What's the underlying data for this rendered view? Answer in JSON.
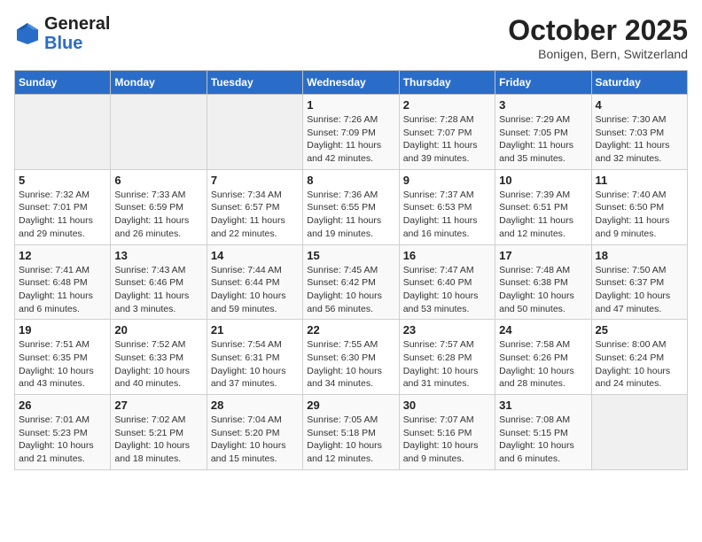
{
  "header": {
    "logo_line1": "General",
    "logo_line2": "Blue",
    "month": "October 2025",
    "location": "Bonigen, Bern, Switzerland"
  },
  "weekdays": [
    "Sunday",
    "Monday",
    "Tuesday",
    "Wednesday",
    "Thursday",
    "Friday",
    "Saturday"
  ],
  "weeks": [
    [
      {
        "day": "",
        "info": ""
      },
      {
        "day": "",
        "info": ""
      },
      {
        "day": "",
        "info": ""
      },
      {
        "day": "1",
        "info": "Sunrise: 7:26 AM\nSunset: 7:09 PM\nDaylight: 11 hours and 42 minutes."
      },
      {
        "day": "2",
        "info": "Sunrise: 7:28 AM\nSunset: 7:07 PM\nDaylight: 11 hours and 39 minutes."
      },
      {
        "day": "3",
        "info": "Sunrise: 7:29 AM\nSunset: 7:05 PM\nDaylight: 11 hours and 35 minutes."
      },
      {
        "day": "4",
        "info": "Sunrise: 7:30 AM\nSunset: 7:03 PM\nDaylight: 11 hours and 32 minutes."
      }
    ],
    [
      {
        "day": "5",
        "info": "Sunrise: 7:32 AM\nSunset: 7:01 PM\nDaylight: 11 hours and 29 minutes."
      },
      {
        "day": "6",
        "info": "Sunrise: 7:33 AM\nSunset: 6:59 PM\nDaylight: 11 hours and 26 minutes."
      },
      {
        "day": "7",
        "info": "Sunrise: 7:34 AM\nSunset: 6:57 PM\nDaylight: 11 hours and 22 minutes."
      },
      {
        "day": "8",
        "info": "Sunrise: 7:36 AM\nSunset: 6:55 PM\nDaylight: 11 hours and 19 minutes."
      },
      {
        "day": "9",
        "info": "Sunrise: 7:37 AM\nSunset: 6:53 PM\nDaylight: 11 hours and 16 minutes."
      },
      {
        "day": "10",
        "info": "Sunrise: 7:39 AM\nSunset: 6:51 PM\nDaylight: 11 hours and 12 minutes."
      },
      {
        "day": "11",
        "info": "Sunrise: 7:40 AM\nSunset: 6:50 PM\nDaylight: 11 hours and 9 minutes."
      }
    ],
    [
      {
        "day": "12",
        "info": "Sunrise: 7:41 AM\nSunset: 6:48 PM\nDaylight: 11 hours and 6 minutes."
      },
      {
        "day": "13",
        "info": "Sunrise: 7:43 AM\nSunset: 6:46 PM\nDaylight: 11 hours and 3 minutes."
      },
      {
        "day": "14",
        "info": "Sunrise: 7:44 AM\nSunset: 6:44 PM\nDaylight: 10 hours and 59 minutes."
      },
      {
        "day": "15",
        "info": "Sunrise: 7:45 AM\nSunset: 6:42 PM\nDaylight: 10 hours and 56 minutes."
      },
      {
        "day": "16",
        "info": "Sunrise: 7:47 AM\nSunset: 6:40 PM\nDaylight: 10 hours and 53 minutes."
      },
      {
        "day": "17",
        "info": "Sunrise: 7:48 AM\nSunset: 6:38 PM\nDaylight: 10 hours and 50 minutes."
      },
      {
        "day": "18",
        "info": "Sunrise: 7:50 AM\nSunset: 6:37 PM\nDaylight: 10 hours and 47 minutes."
      }
    ],
    [
      {
        "day": "19",
        "info": "Sunrise: 7:51 AM\nSunset: 6:35 PM\nDaylight: 10 hours and 43 minutes."
      },
      {
        "day": "20",
        "info": "Sunrise: 7:52 AM\nSunset: 6:33 PM\nDaylight: 10 hours and 40 minutes."
      },
      {
        "day": "21",
        "info": "Sunrise: 7:54 AM\nSunset: 6:31 PM\nDaylight: 10 hours and 37 minutes."
      },
      {
        "day": "22",
        "info": "Sunrise: 7:55 AM\nSunset: 6:30 PM\nDaylight: 10 hours and 34 minutes."
      },
      {
        "day": "23",
        "info": "Sunrise: 7:57 AM\nSunset: 6:28 PM\nDaylight: 10 hours and 31 minutes."
      },
      {
        "day": "24",
        "info": "Sunrise: 7:58 AM\nSunset: 6:26 PM\nDaylight: 10 hours and 28 minutes."
      },
      {
        "day": "25",
        "info": "Sunrise: 8:00 AM\nSunset: 6:24 PM\nDaylight: 10 hours and 24 minutes."
      }
    ],
    [
      {
        "day": "26",
        "info": "Sunrise: 7:01 AM\nSunset: 5:23 PM\nDaylight: 10 hours and 21 minutes."
      },
      {
        "day": "27",
        "info": "Sunrise: 7:02 AM\nSunset: 5:21 PM\nDaylight: 10 hours and 18 minutes."
      },
      {
        "day": "28",
        "info": "Sunrise: 7:04 AM\nSunset: 5:20 PM\nDaylight: 10 hours and 15 minutes."
      },
      {
        "day": "29",
        "info": "Sunrise: 7:05 AM\nSunset: 5:18 PM\nDaylight: 10 hours and 12 minutes."
      },
      {
        "day": "30",
        "info": "Sunrise: 7:07 AM\nSunset: 5:16 PM\nDaylight: 10 hours and 9 minutes."
      },
      {
        "day": "31",
        "info": "Sunrise: 7:08 AM\nSunset: 5:15 PM\nDaylight: 10 hours and 6 minutes."
      },
      {
        "day": "",
        "info": ""
      }
    ]
  ]
}
